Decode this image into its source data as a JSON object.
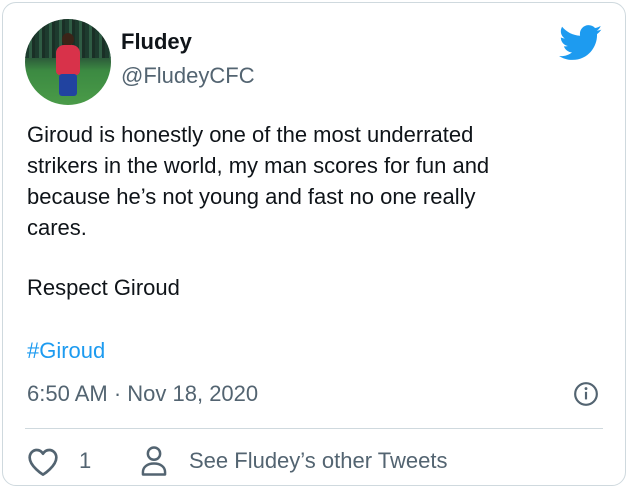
{
  "author": {
    "name": "Fludey",
    "handle": "@FludeyCFC"
  },
  "tweet": {
    "lines": [
      "Giroud is honestly one of the most underrated",
      "strikers in the world, my man scores for fun and",
      "because he’s not young and fast no one really",
      "cares."
    ],
    "respect": "Respect Giroud",
    "hashtag": "#Giroud",
    "timestamp": "6:50 AM · Nov 18, 2020"
  },
  "actions": {
    "like_count": "1",
    "see_more_label": "See Fludey’s other Tweets"
  },
  "icons": {
    "brand": "twitter-bird-icon",
    "info": "info-icon",
    "like": "heart-icon",
    "profile": "person-icon"
  },
  "colors": {
    "brand_blue": "#1d9bf0",
    "text": "#0f1419",
    "secondary": "#536471",
    "border": "#cfd9de"
  }
}
